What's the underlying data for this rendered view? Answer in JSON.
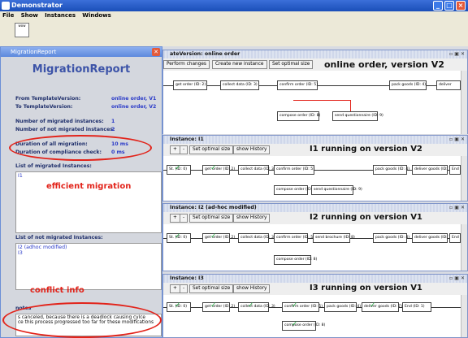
{
  "app": {
    "title": "Demonstrator",
    "menu": [
      "File",
      "Show",
      "Instances",
      "Windows"
    ],
    "toolbar_icon_label": "wow"
  },
  "report": {
    "window_title": "MigrationReport",
    "heading": "MigrationReport",
    "from_label": "From TemplateVersion:",
    "from_value": "online order, V1",
    "to_label": "To TemplateVersion:",
    "to_value": "online order, V2",
    "migrated_count_label": "Number of migrated instances:",
    "migrated_count": "1",
    "not_migrated_count_label": "Number of not migrated instances:",
    "not_migrated_count": "2",
    "duration_migration_label": "Duration of all migration:",
    "duration_migration": "10 ms",
    "duration_compliance_label": "Duration of compliance check:",
    "duration_compliance": "0 ms",
    "migrated_list_label": "List of migrated Instances:",
    "migrated_list": [
      "I1"
    ],
    "not_migrated_list_label": "List of not migrated Instances:",
    "not_migrated_list": [
      "I2 (adhoc modified)",
      "I3"
    ],
    "notes_label": "notes",
    "notes_lines": [
      "s canceled, because there is a deadlock causing cylce",
      "ce this process progressed too far for these modifications"
    ],
    "annotation_efficient": "efficient migration",
    "annotation_conflict": "conflict info"
  },
  "panels": [
    {
      "title": "ateVersion: online order",
      "buttons": [
        "Perform changes",
        "Create new instance",
        "Set optimal size"
      ],
      "headline": "online order, version V2",
      "nodes": [
        "get order (ID: 2)",
        "collect data (ID: 3)",
        "confirm order (ID: 5)",
        "pack goods (ID: 4)",
        "deliver",
        "compose order (ID: 8)",
        "send questionnaire (ID: 9)"
      ]
    },
    {
      "title": "Instance: I1",
      "buttons": [
        "+",
        "-",
        "Set optimal size",
        "show History"
      ],
      "headline": "I1 running on version V2",
      "nodes": [
        "St. (ID: 0)",
        "get order (ID: 2)",
        "collect data (ID: 3)",
        "confirm order (ID: 5)",
        "pack goods (ID: 4)",
        "deliver goods (ID: 7)",
        "End",
        "compose order (ID: 8)",
        "send questionnaire (ID: 9)"
      ]
    },
    {
      "title": "Instance: I2 (ad-hoc modified)",
      "buttons": [
        "+",
        "-",
        "Set optimal size",
        "show History"
      ],
      "headline": "I2 running on version V1",
      "nodes": [
        "St. (ID: 0)",
        "get order (ID: 2)",
        "collect data (ID: 3)",
        "confirm order (ID: 5)",
        "send brochure (ID: 8)",
        "pack goods (ID: 4)",
        "deliver goods (ID: 7)",
        "End",
        "compose order (ID: 8)"
      ]
    },
    {
      "title": "Instance: I3",
      "buttons": [
        "+",
        "-",
        "Set optimal size",
        "show History"
      ],
      "headline": "I3 running on version V1",
      "nodes": [
        "St. (ID: 0)",
        "get order (ID: 2)",
        "collect data (ID: 3)",
        "confirm order (ID: 5)",
        "pack goods (ID: 4)",
        "deliver goods (ID: 7)",
        "End (ID: 1)",
        "compose order (ID: 8)"
      ]
    }
  ],
  "colors": {
    "accent": "#3c53a8",
    "annotation": "#e2231a",
    "value": "#2a3ac8"
  }
}
